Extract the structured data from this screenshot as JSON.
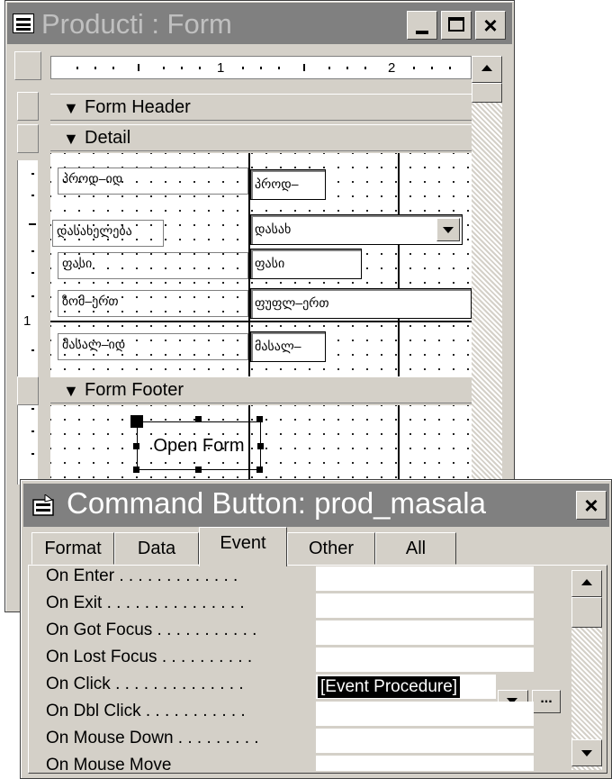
{
  "form_window": {
    "title": "Producti : Form",
    "buttons": {
      "minimize": "_",
      "maximize": "□",
      "close": "×"
    },
    "ruler": {
      "marks": [
        "1",
        "2"
      ]
    },
    "sections": {
      "header": "Form Header",
      "detail": "Detail",
      "footer": "Form Footer"
    },
    "vertical_ruler_mark": "1",
    "detail_rows": [
      {
        "label": "პროდ–იდ",
        "value": "პროდ–"
      },
      {
        "label": "დასახელება",
        "value": "დასახ"
      },
      {
        "label": "ფასი",
        "value": "ფასი"
      },
      {
        "label": "ზომ–ერთ",
        "value": "ფუფლ–ერთ"
      },
      {
        "label": "მასალ–იდ",
        "value": "მასალ–"
      }
    ],
    "footer_button": "Open Form"
  },
  "property_sheet": {
    "title": "Command Button: prod_masala",
    "close": "×",
    "tabs": [
      "Format",
      "Data",
      "Event",
      "Other",
      "All"
    ],
    "active_tab": "Event",
    "properties": [
      {
        "name": "On Enter . . . . . . . . . . . . .",
        "value": ""
      },
      {
        "name": "On Exit . . . . . . . . . . . . . . .",
        "value": ""
      },
      {
        "name": "On Got Focus . . . . . . . . . . .",
        "value": ""
      },
      {
        "name": "On Lost Focus . . . . . . . . . .",
        "value": ""
      },
      {
        "name": "On Click . . . . . . . . . . . . . .",
        "value": "[Event Procedure]"
      },
      {
        "name": "On Dbl Click . . . . . . . . . . .",
        "value": ""
      },
      {
        "name": "On Mouse Down . . . . . . . . .",
        "value": ""
      },
      {
        "name": "On Mouse Move",
        "value": ""
      }
    ],
    "builder_button": "..."
  }
}
